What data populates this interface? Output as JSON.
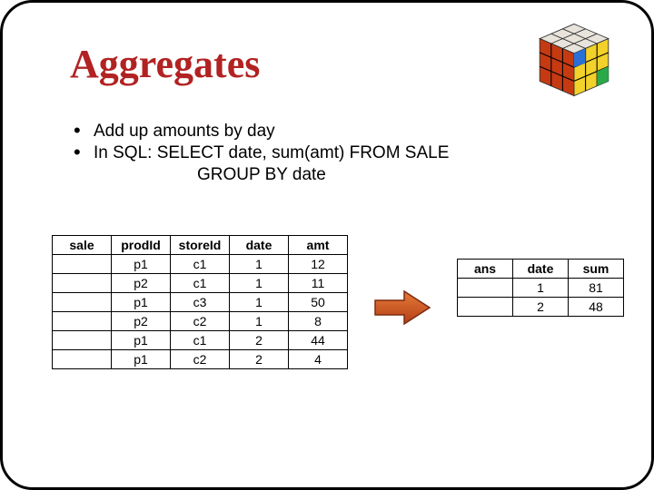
{
  "title": "Aggregates",
  "bullets": {
    "b1": "Add up amounts by day",
    "b2": "In SQL:  SELECT date, sum(amt) FROM SALE",
    "b2_cont": "GROUP BY date"
  },
  "sale_table": {
    "headers": [
      "sale",
      "prodId",
      "storeId",
      "date",
      "amt"
    ],
    "rows": [
      [
        "",
        "p1",
        "c1",
        "1",
        "12"
      ],
      [
        "",
        "p2",
        "c1",
        "1",
        "11"
      ],
      [
        "",
        "p1",
        "c3",
        "1",
        "50"
      ],
      [
        "",
        "p2",
        "c2",
        "1",
        "8"
      ],
      [
        "",
        "p1",
        "c1",
        "2",
        "44"
      ],
      [
        "",
        "p1",
        "c2",
        "2",
        "4"
      ]
    ]
  },
  "ans_table": {
    "headers": [
      "ans",
      "date",
      "sum"
    ],
    "rows": [
      [
        "",
        "1",
        "81"
      ],
      [
        "",
        "2",
        "48"
      ]
    ]
  },
  "icons": {
    "corner": "rubiks-cube-icon",
    "arrow": "right-arrow-icon"
  }
}
